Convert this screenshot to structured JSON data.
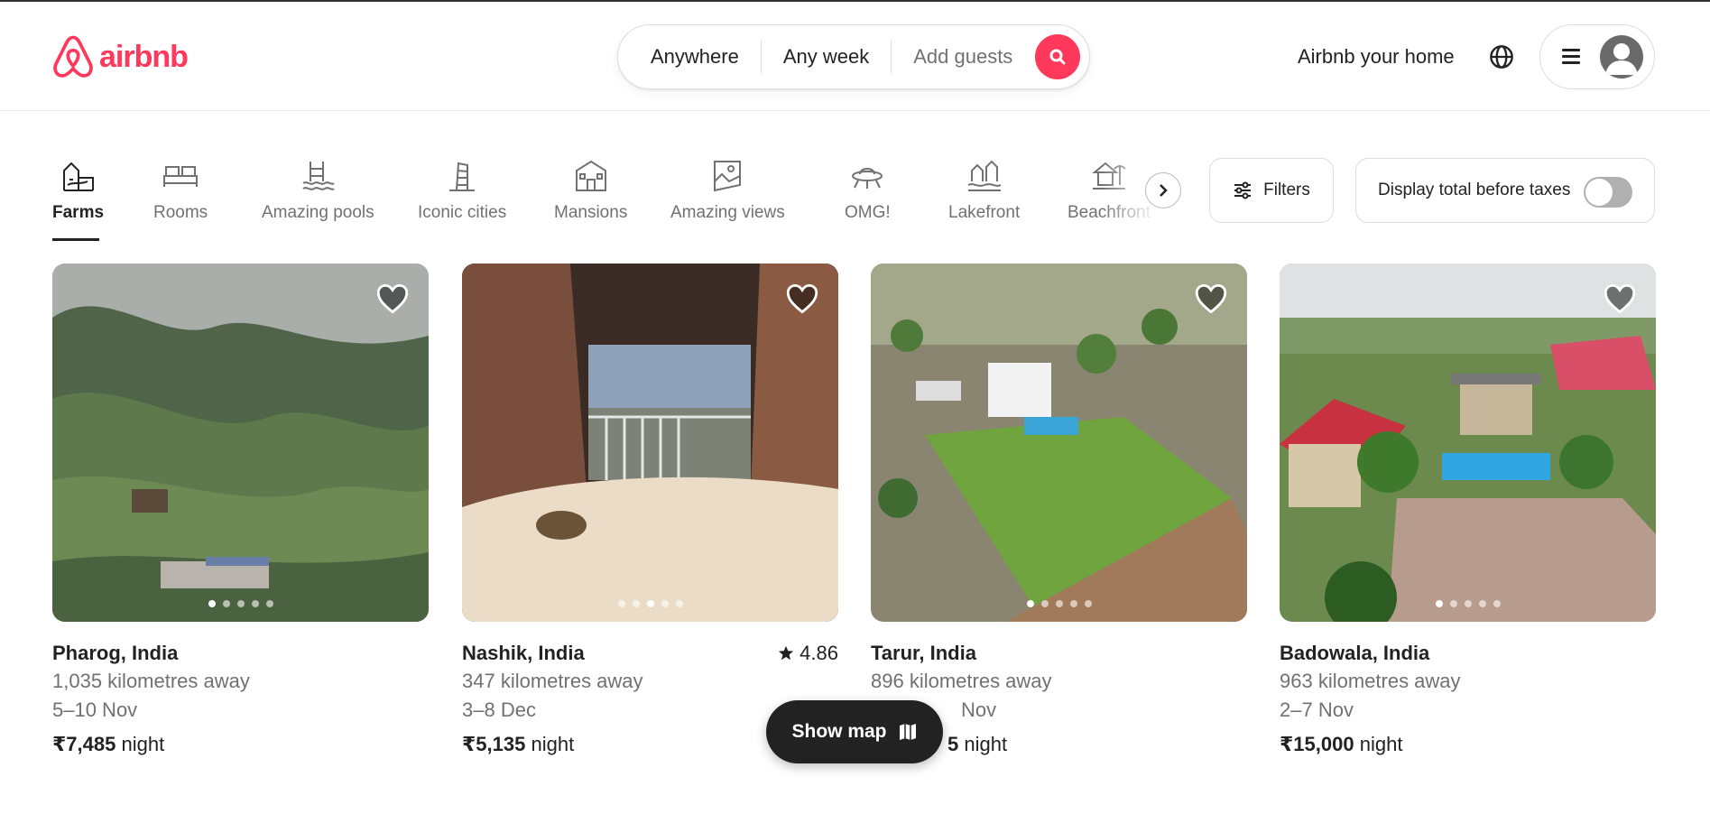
{
  "brand": {
    "name": "airbnb",
    "color": "#ff385c"
  },
  "search": {
    "where": "Anywhere",
    "when": "Any week",
    "guests": "Add guests"
  },
  "header": {
    "host_link": "Airbnb your home"
  },
  "categories": [
    {
      "label": "Farms",
      "icon": "farm-icon",
      "active": true
    },
    {
      "label": "Rooms",
      "icon": "bed-icon"
    },
    {
      "label": "Amazing pools",
      "icon": "pool-icon"
    },
    {
      "label": "Iconic cities",
      "icon": "tower-icon"
    },
    {
      "label": "Mansions",
      "icon": "mansion-icon"
    },
    {
      "label": "Amazing views",
      "icon": "picture-icon"
    },
    {
      "label": "OMG!",
      "icon": "ufo-icon"
    },
    {
      "label": "Lakefront",
      "icon": "lakefront-icon"
    },
    {
      "label": "Beachfront",
      "icon": "beach-hut-icon"
    }
  ],
  "filters_label": "Filters",
  "taxes_toggle": {
    "label": "Display total before taxes",
    "on": false
  },
  "listings": [
    {
      "location": "Pharog, India",
      "distance": "1,035 kilometres away",
      "dates": "5–10 Nov",
      "price": "₹7,485",
      "unit": "night",
      "rating": ""
    },
    {
      "location": "Nashik, India",
      "distance": "347 kilometres away",
      "dates": "3–8 Dec",
      "price": "₹5,135",
      "unit": "night",
      "rating": "4.86"
    },
    {
      "location": "Tarur, India",
      "distance": "896 kilometres away",
      "dates": "Nov",
      "price": "5",
      "unit": "night",
      "rating": ""
    },
    {
      "location": "Badowala, India",
      "distance": "963 kilometres away",
      "dates": "2–7 Nov",
      "price": "₹15,000",
      "unit": "night",
      "rating": ""
    }
  ],
  "show_map": "Show map"
}
